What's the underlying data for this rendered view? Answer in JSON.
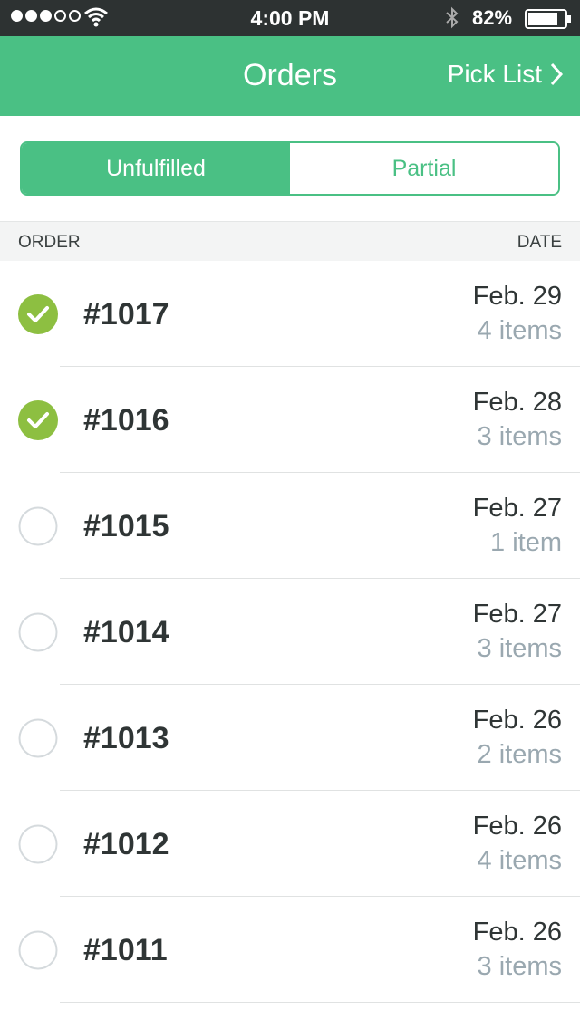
{
  "status_bar": {
    "time": "4:00 PM",
    "battery_percent": "82%",
    "signal_bars_filled": 3,
    "signal_bars_total": 5,
    "battery_level": 0.82
  },
  "nav": {
    "title": "Orders",
    "right_button": "Pick List"
  },
  "segments": {
    "unfulfilled": "Unfulfilled",
    "partial": "Partial",
    "selected": "Unfulfilled"
  },
  "list_header": {
    "order": "ORDER",
    "date": "DATE"
  },
  "orders": [
    {
      "number": "#1017",
      "date": "Feb. 29",
      "items": "4 items",
      "checked": true
    },
    {
      "number": "#1016",
      "date": "Feb. 28",
      "items": "3 items",
      "checked": true
    },
    {
      "number": "#1015",
      "date": "Feb. 27",
      "items": "1 item",
      "checked": false
    },
    {
      "number": "#1014",
      "date": "Feb. 27",
      "items": "3 items",
      "checked": false
    },
    {
      "number": "#1013",
      "date": "Feb. 26",
      "items": "2 items",
      "checked": false
    },
    {
      "number": "#1012",
      "date": "Feb. 26",
      "items": "4 items",
      "checked": false
    },
    {
      "number": "#1011",
      "date": "Feb. 26",
      "items": "3 items",
      "checked": false
    }
  ],
  "colors": {
    "brand_green": "#4ac084",
    "check_green": "#8dbf41",
    "status_bar_bg": "#2d3232",
    "muted_text": "#9aa8b0",
    "unchecked_border": "#d5dadd"
  },
  "icons": {
    "signal": "signal-dots-icon",
    "wifi": "wifi-icon",
    "bluetooth": "bluetooth-icon",
    "battery": "battery-icon",
    "pick_list_chevron": "chevron-right-icon",
    "checked": "checkmark-circle-icon",
    "unchecked": "empty-circle-icon"
  }
}
